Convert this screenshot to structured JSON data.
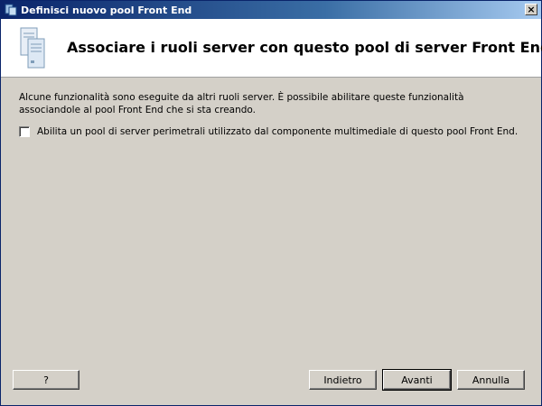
{
  "window": {
    "title": "Definisci nuovo pool Front End",
    "close_label": "×"
  },
  "header": {
    "title": "Associare i ruoli server con questo pool di server Front End"
  },
  "main": {
    "description": "Alcune funzionalità sono eseguite da altri ruoli server. È possibile abilitare queste funzionalità associandole al pool Front End che si sta creando.",
    "checkbox_label": "Abilita un pool di server perimetrali utilizzato dal componente multimediale di questo pool Front End.",
    "checkbox_checked": false
  },
  "buttons": {
    "help": "?",
    "back": "Indietro",
    "next": "Avanti",
    "cancel": "Annulla"
  }
}
